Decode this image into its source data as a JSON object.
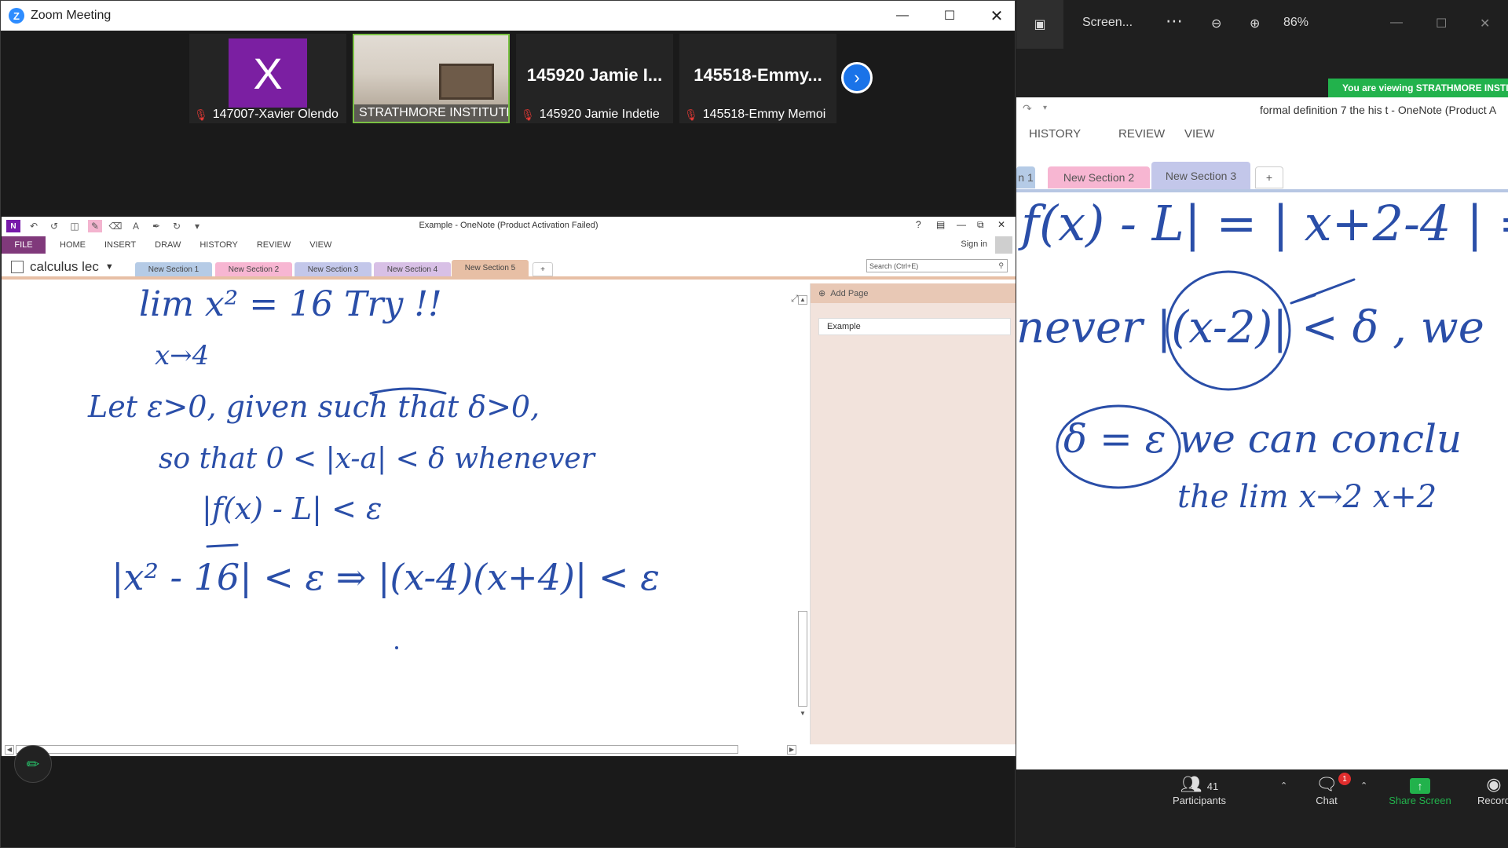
{
  "zoom": {
    "title": "Zoom Meeting",
    "participants": [
      {
        "initial": "X",
        "name": "147007-Xavier Olendo",
        "muted": true
      },
      {
        "name": "STRATHMORE INSTITUTE",
        "video": true
      },
      {
        "display": "145920 Jamie I...",
        "name": "145920 Jamie Indetie",
        "muted": true
      },
      {
        "display": "145518-Emmy...",
        "name": "145518-Emmy Memoi",
        "muted": true
      }
    ]
  },
  "onenote": {
    "title": "Example - OneNote (Product Activation Failed)",
    "ribbon_tabs": [
      "FILE",
      "HOME",
      "INSERT",
      "DRAW",
      "HISTORY",
      "REVIEW",
      "VIEW"
    ],
    "sign_in": "Sign in",
    "notebook": "calculus  lec",
    "sections": [
      {
        "label": "New Section 1",
        "color": "#b5cbe6"
      },
      {
        "label": "New Section 2",
        "color": "#f7b6d2"
      },
      {
        "label": "New Section 3",
        "color": "#c3c7ea"
      },
      {
        "label": "New Section 4",
        "color": "#d8c0e6"
      },
      {
        "label": "New Section 5",
        "color": "#e7bfa5",
        "active": true
      }
    ],
    "add_section": "+",
    "search_placeholder": "Search (Ctrl+E)",
    "add_page": "Add Page",
    "pages": [
      "Example"
    ],
    "ink_lines": [
      "lim  x² = 16   Try !!",
      "x→4",
      "Let ε>0, given  such that  δ>0,",
      "so that   0 < |x-a| < δ  whenever",
      "|f(x) - L| < ε",
      "|x² - 16| < ε ⇒  |(x-4)(x+4)| < ε"
    ]
  },
  "viewer": {
    "title": "Screen...",
    "zoom_level": "86%",
    "banner": "You are viewing STRATHMORE INSTITUTE",
    "doc_title": "formal definition 7 the his t - OneNote (Product A",
    "ribbon_tabs": [
      "HISTORY",
      "REVIEW",
      "VIEW"
    ],
    "tabs": [
      {
        "label": "n 1",
        "color": "#b5cbe6"
      },
      {
        "label": "New Section 2",
        "color": "#f7b6d2"
      },
      {
        "label": "New Section 3",
        "color": "#c3c7ea",
        "active": true
      }
    ],
    "add_tab": "+",
    "ink_lines": [
      "f(x) - L| = | x+2-4 | =",
      "never  |(x-2)| < δ  , we",
      "δ = ε   we can conclu",
      "the  lim x→2   x+2"
    ],
    "toolbar": {
      "participants_label": "Participants",
      "participants_count": "41",
      "chat_label": "Chat",
      "chat_badge": "1",
      "share_label": "Share Screen",
      "record_label": "Record"
    }
  },
  "colors": {
    "zoom_blue": "#2d8cff",
    "share_green": "#22b24c",
    "ink_blue": "#2a4ea8",
    "file_tab": "#80397b"
  }
}
